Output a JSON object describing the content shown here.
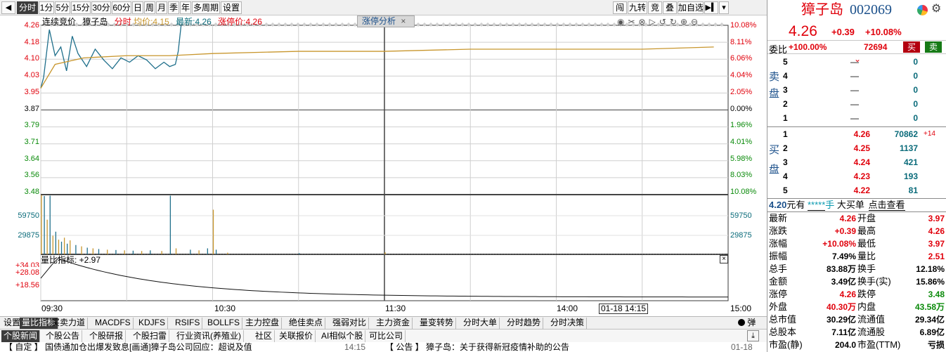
{
  "toolbar": {
    "back_icon": "back-arrow-icon",
    "periods": [
      "分时",
      "1分",
      "5分",
      "15分",
      "30分",
      "60分",
      "日",
      "周",
      "月",
      "季",
      "年",
      "多周期",
      "设置"
    ],
    "selected_period": "分时",
    "right_buttons": [
      "闯",
      "九转",
      "竞",
      "叠",
      "加自选"
    ],
    "nav_icon": "play-next-icon",
    "dropdown_icon": "chevron-down-icon"
  },
  "chart_header": {
    "auction_label": "连续竞价",
    "stock_name": "獐子岛",
    "mode_label": "分时",
    "avg_label": "均价:",
    "avg_value": "4.15",
    "latest_label": "最新:",
    "latest_value": "4.26",
    "limit_label": "涨停价:",
    "limit_value": "4.26",
    "tag_label": "涨停分析",
    "tag_close": "×",
    "tool_icons": [
      "eye-icon",
      "scissors-icon",
      "close-circle-icon",
      "play-circle-icon",
      "refresh-left-icon",
      "refresh-right-icon",
      "plus-circle-icon",
      "minus-circle-icon"
    ]
  },
  "price_axis": {
    "left": [
      "4.26",
      "4.18",
      "4.10",
      "4.03",
      "3.95",
      "3.87",
      "3.79",
      "3.71",
      "3.64",
      "3.56",
      "3.48"
    ],
    "right": [
      "10.08%",
      "8.11%",
      "6.06%",
      "4.04%",
      "2.05%",
      "0.00%",
      "1.96%",
      "4.01%",
      "5.98%",
      "8.03%",
      "10.08%"
    ]
  },
  "volume_axis": {
    "values": [
      "59750",
      "29875"
    ]
  },
  "volume_ratio": {
    "label": "量比指标: +2.97",
    "ticks": [
      "+34.03",
      "+28.08",
      "+18.56"
    ],
    "close_icon": "close-icon"
  },
  "time_axis": {
    "labels": [
      "09:30",
      "10:30",
      "11:30",
      "14:00",
      "15:00"
    ],
    "cursor_label": "01-18 14:15"
  },
  "chart_data": {
    "type": "line",
    "title": "",
    "x_range": [
      "09:30",
      "15:00"
    ],
    "ylim": [
      3.48,
      4.26
    ],
    "prev_close": 3.87,
    "series": [
      {
        "name": "分时",
        "x": [
          "09:30",
          "09:31",
          "09:33",
          "09:35",
          "09:37",
          "09:39",
          "09:41",
          "09:43",
          "09:46",
          "09:49",
          "09:52",
          "09:55",
          "09:58",
          "10:01",
          "10:04",
          "10:07",
          "10:10",
          "10:13",
          "10:15",
          "10:17",
          "10:18",
          "10:19"
        ],
        "values": [
          3.97,
          4.02,
          4.24,
          4.12,
          4.16,
          4.05,
          4.21,
          4.13,
          4.07,
          4.15,
          4.1,
          4.06,
          4.11,
          4.09,
          4.12,
          4.1,
          4.06,
          4.09,
          4.07,
          4.08,
          4.14,
          4.26
        ]
      },
      {
        "name": "均价",
        "x": [
          "09:30",
          "09:35",
          "09:45",
          "10:00",
          "10:15",
          "10:30",
          "11:00",
          "11:30",
          "13:30",
          "14:00",
          "14:30",
          "14:55"
        ],
        "values": [
          3.97,
          4.08,
          4.11,
          4.12,
          4.12,
          4.13,
          4.14,
          4.14,
          4.15,
          4.15,
          4.15,
          4.16
        ]
      }
    ],
    "volume_ylim": [
      0,
      89625
    ],
    "volume_bars": [
      {
        "x": "09:30",
        "v": 89000
      },
      {
        "x": "09:31",
        "v": 87500
      },
      {
        "x": "09:32",
        "v": 52000
      },
      {
        "x": "09:33",
        "v": 88000
      },
      {
        "x": "09:34",
        "v": 28000
      },
      {
        "x": "09:35",
        "v": 34000
      },
      {
        "x": "09:36",
        "v": 22000
      },
      {
        "x": "09:37",
        "v": 19000
      },
      {
        "x": "09:38",
        "v": 25000
      },
      {
        "x": "09:39",
        "v": 16000
      },
      {
        "x": "09:40",
        "v": 21000
      },
      {
        "x": "09:42",
        "v": 14000
      },
      {
        "x": "09:44",
        "v": 12000
      },
      {
        "x": "09:46",
        "v": 10000
      },
      {
        "x": "09:48",
        "v": 9000
      },
      {
        "x": "09:50",
        "v": 8000
      },
      {
        "x": "09:53",
        "v": 7000
      },
      {
        "x": "09:56",
        "v": 6500
      },
      {
        "x": "09:59",
        "v": 6000
      },
      {
        "x": "10:02",
        "v": 5500
      },
      {
        "x": "10:05",
        "v": 5000
      },
      {
        "x": "10:08",
        "v": 6000
      },
      {
        "x": "10:12",
        "v": 5000
      },
      {
        "x": "10:15",
        "v": 88000
      },
      {
        "x": "10:17",
        "v": 9000
      },
      {
        "x": "10:22",
        "v": 7000
      },
      {
        "x": "10:25",
        "v": 6000
      },
      {
        "x": "10:28",
        "v": 9000
      },
      {
        "x": "10:30",
        "v": 67000
      },
      {
        "x": "10:31",
        "v": 7000
      },
      {
        "x": "10:35",
        "v": 2500
      },
      {
        "x": "11:00",
        "v": 1800
      },
      {
        "x": "11:30",
        "v": 3000
      }
    ]
  },
  "quote": {
    "name": "獐子岛",
    "code": "002069",
    "price": "4.26",
    "change": "+0.39",
    "change_pct": "+10.08%",
    "icons": [
      "pie-chart-icon",
      "gear-icon"
    ],
    "webi_label": "委比",
    "webi_value": "+100.00%",
    "weicha_value": "72694",
    "buy_btn": "买",
    "sell_btn": "卖",
    "sell_side_label": [
      "卖",
      "盘"
    ],
    "buy_side_label": [
      "买",
      "盘"
    ],
    "asks": [
      {
        "level": "5",
        "price": "—",
        "vol": "0"
      },
      {
        "level": "4",
        "price": "—",
        "vol": "0"
      },
      {
        "level": "3",
        "price": "—",
        "vol": "0"
      },
      {
        "level": "2",
        "price": "—",
        "vol": "0"
      },
      {
        "level": "1",
        "price": "—",
        "vol": "0"
      }
    ],
    "bids": [
      {
        "level": "1",
        "price": "4.26",
        "vol": "70862",
        "delta": "+14"
      },
      {
        "level": "2",
        "price": "4.25",
        "vol": "1137",
        "delta": ""
      },
      {
        "level": "3",
        "price": "4.24",
        "vol": "421",
        "delta": ""
      },
      {
        "level": "4",
        "price": "4.23",
        "vol": "193",
        "delta": ""
      },
      {
        "level": "5",
        "price": "4.22",
        "vol": "81",
        "delta": ""
      }
    ],
    "bigorder": {
      "a": "4.20",
      "b": "元有",
      "c": "*****",
      "d": "手",
      "e": "大买单",
      "f": "点击查看"
    },
    "stats": [
      {
        "l": "最新",
        "v": "4.26",
        "vc": "red",
        "l2": "开盘",
        "v2": "3.97",
        "v2c": "red"
      },
      {
        "l": "涨跌",
        "v": "+0.39",
        "vc": "red",
        "l2": "最高",
        "v2": "4.26",
        "v2c": "red"
      },
      {
        "l": "涨幅",
        "v": "+10.08%",
        "vc": "red",
        "l2": "最低",
        "v2": "3.97",
        "v2c": "red"
      },
      {
        "l": "振幅",
        "v": "7.49%",
        "vc": "blk",
        "l2": "量比",
        "v2": "2.51",
        "v2c": "red"
      },
      {
        "l": "总手",
        "v": "83.88万",
        "vc": "blk",
        "l2": "换手",
        "v2": "12.18%",
        "v2c": "blk"
      },
      {
        "l": "金额",
        "v": "3.49亿",
        "vc": "blk",
        "l2": "换手(实)",
        "v2": "15.86%",
        "v2c": "blk"
      },
      {
        "l": "涨停",
        "v": "4.26",
        "vc": "red",
        "l2": "跌停",
        "v2": "3.48",
        "v2c": "grn"
      },
      {
        "l": "外盘",
        "v": "40.30万",
        "vc": "red",
        "l2": "内盘",
        "v2": "43.58万",
        "v2c": "grn"
      },
      {
        "l": "总市值",
        "v": "30.29亿",
        "vc": "blk",
        "l2": "流通值",
        "v2": "29.34亿",
        "v2c": "blk"
      },
      {
        "l": "总股本",
        "v": "7.11亿",
        "vc": "blk",
        "l2": "流通股",
        "v2": "6.89亿",
        "v2c": "blk"
      },
      {
        "l": "市盈(静)",
        "v": "204.0",
        "vc": "blk",
        "l2": "市盈(TTM)",
        "v2": "亏损",
        "v2c": "blk"
      }
    ]
  },
  "bottom_tabs": [
    "设置",
    "量比指标",
    "买卖力道",
    "MACDFS",
    "KDJFS",
    "RSIFS",
    "BOLLFS",
    "主力控盘",
    "绝佳卖点",
    "强弱对比",
    "主力资金",
    "量变转势",
    "分时大单",
    "分时趋势",
    "分时决策"
  ],
  "bottom_selected": "量比指标",
  "bottom_right": {
    "icon": "dot-icon",
    "label": "弹"
  },
  "news_tabs": [
    "个股新闻",
    "个股公告",
    "个股研报",
    "个股扫雷",
    "行业资讯(养殖业)",
    "社区",
    "关联报价",
    "AI相似个股",
    "可比公司"
  ],
  "news_selected": "个股新闻",
  "news_ticker": [
    "【 自定 】 国债通加仓出爆发致息[画通]獐子岛公司回应：超说及值",
    "14:15",
    "【 公告 】 獐子岛：关于获得新冠疫情补助的公告",
    "01-18"
  ],
  "colors": {
    "up": "#e0000b",
    "down": "#0a8a0a",
    "price_line": "#1f6f8b",
    "avg_line": "#c8962d",
    "frame": "#3a3a3a"
  }
}
